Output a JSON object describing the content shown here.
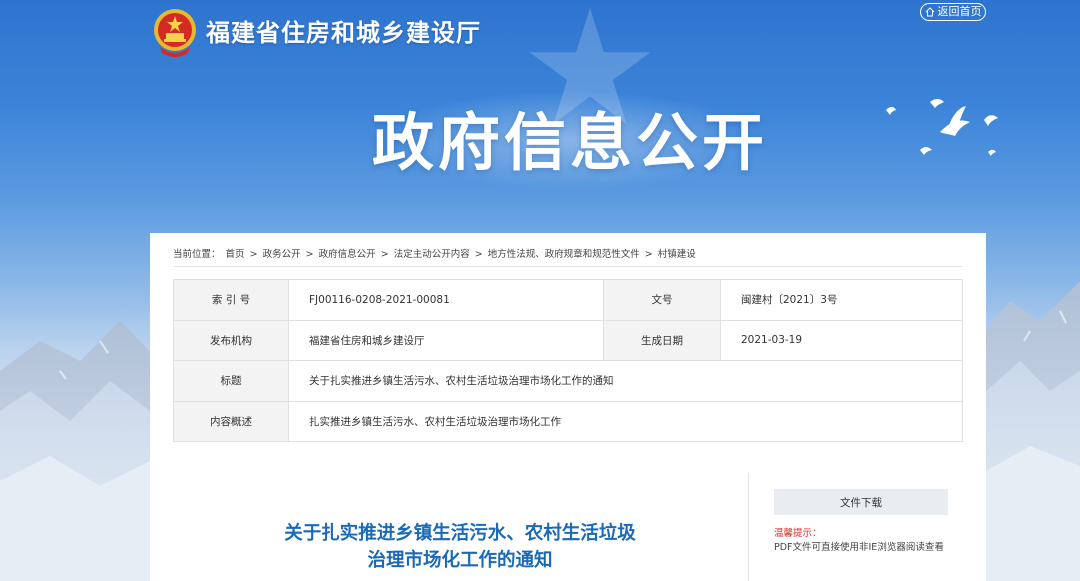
{
  "header": {
    "site_name": "福建省住房和城乡建设厅",
    "home_label": "返回首页",
    "hero_title": "政府信息公开"
  },
  "breadcrumb": {
    "prefix": "当前位置：",
    "items": [
      "首页",
      "政务公开",
      "政府信息公开",
      "法定主动公开内容",
      "地方性法规、政府规章和规范性文件",
      "村镇建设"
    ],
    "separator": ">"
  },
  "meta": {
    "index_label": "索 引 号",
    "index_value": "FJ00116-0208-2021-00081",
    "docno_label": "文号",
    "docno_value": "闽建村〔2021〕3号",
    "org_label": "发布机构",
    "org_value": "福建省住房和城乡建设厅",
    "date_label": "生成日期",
    "date_value": "2021-03-19",
    "title_label": "标题",
    "title_value": "关于扎实推进乡镇生活污水、农村生活垃圾治理市场化工作的通知",
    "summary_label": "内容概述",
    "summary_value": "扎实推进乡镇生活污水、农村生活垃圾治理市场化工作"
  },
  "article": {
    "title_line1": "关于扎实推进乡镇生活污水、农村生活垃圾",
    "title_line2": "治理市场化工作的通知"
  },
  "sidebar": {
    "download_label": "文件下载",
    "tip_title": "温馨提示：",
    "tip_text": "PDF文件可直接使用非IE浏览器阅读查看"
  },
  "colors": {
    "banner_top": "#2e74cf",
    "title_blue": "#1b6ab8",
    "tip_red": "#d9302b"
  }
}
